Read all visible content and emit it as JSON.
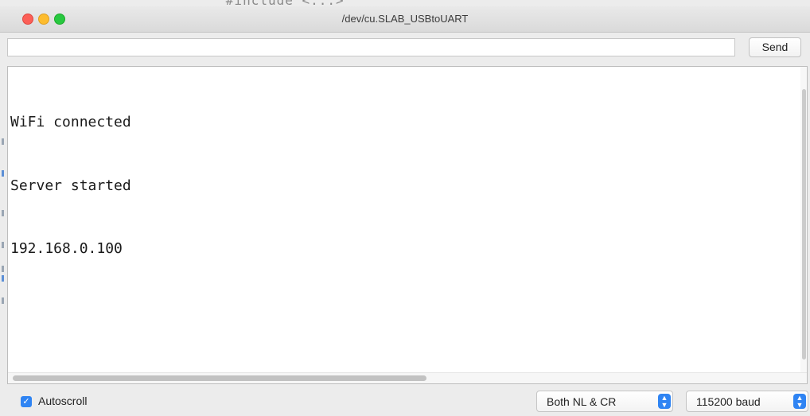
{
  "background_code": "      #include <...>",
  "window": {
    "title": "/dev/cu.SLAB_USBtoUART"
  },
  "send_bar": {
    "input_value": "",
    "send_label": "Send"
  },
  "output": {
    "lines": [
      "WiFi connected",
      "Server started",
      "192.168.0.100"
    ]
  },
  "status_bar": {
    "autoscroll_label": "Autoscroll",
    "autoscroll_checked": true,
    "line_ending_selected": "Both NL & CR",
    "baud_selected": "115200 baud"
  },
  "colors": {
    "accent": "#2f84f3",
    "close": "#fc5f57",
    "minimize": "#fdbc2e",
    "zoom": "#28c840"
  },
  "icons": {
    "checkbox": "checkmark-icon",
    "stepper": "up-down-chevron-icon"
  }
}
